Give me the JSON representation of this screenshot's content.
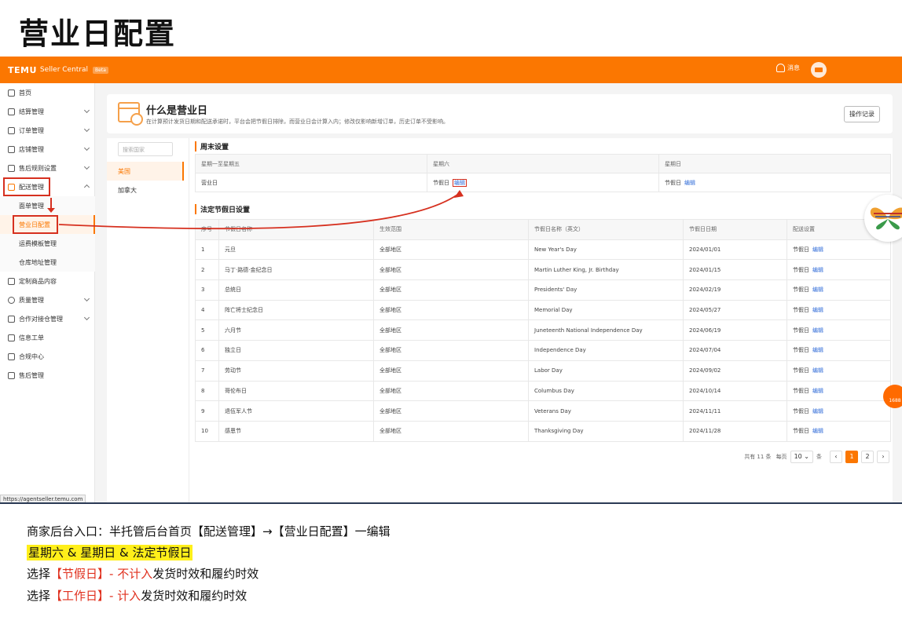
{
  "page_title": "营业日配置",
  "app": {
    "brand": "TEMU",
    "brand_sub": "Seller Central",
    "badge": "Beta",
    "messages_label": "消息",
    "status_url": "https://agentseller.temu.com"
  },
  "sidebar": {
    "items": [
      {
        "label": "首页",
        "icon": "home-icon"
      },
      {
        "label": "结算管理",
        "icon": "wallet-icon"
      },
      {
        "label": "订单管理",
        "icon": "cart-icon"
      },
      {
        "label": "店铺管理",
        "icon": "store-icon"
      },
      {
        "label": "售后规则设置",
        "icon": "rules-icon"
      },
      {
        "label": "配送管理",
        "icon": "truck-icon"
      },
      {
        "label": "面单管理",
        "icon": ""
      },
      {
        "label": "营业日配置",
        "icon": ""
      },
      {
        "label": "运费模板管理",
        "icon": ""
      },
      {
        "label": "仓库地址管理",
        "icon": ""
      },
      {
        "label": "定制商品内容",
        "icon": "custom-icon"
      },
      {
        "label": "质量管理",
        "icon": "shield-icon"
      },
      {
        "label": "合作对接仓管理",
        "icon": "warehouse-icon"
      },
      {
        "label": "信息工单",
        "icon": "ticket-icon"
      },
      {
        "label": "合规中心",
        "icon": "compliance-icon"
      },
      {
        "label": "售后管理",
        "icon": "aftersale-icon"
      }
    ]
  },
  "info": {
    "title": "什么是营业日",
    "desc": "在计算预计发货日期和配送承诺时，平台会把节假日排除，而营业日会计算入内；修改仅影响新增订单，历史订单不受影响。",
    "log_button": "操作记录"
  },
  "countries": {
    "search_placeholder": "搜索国家",
    "items": [
      "美国",
      "加拿大"
    ]
  },
  "weekend": {
    "title": "周末设置",
    "headers": [
      "星期一至星期五",
      "星期六",
      "星期日"
    ],
    "row": [
      "营业日",
      "节假日",
      "节假日"
    ],
    "edit_label": "编辑"
  },
  "holidays": {
    "title": "法定节假日设置",
    "headers": [
      "序号",
      "节假日名称",
      "生效范围",
      "节假日名称（英文）",
      "节假日日期",
      "配送设置"
    ],
    "rows": [
      [
        "1",
        "元旦",
        "全部地区",
        "New Year's Day",
        "2024/01/01",
        "节假日"
      ],
      [
        "2",
        "马丁·路德·金纪念日",
        "全部地区",
        "Martin Luther King, Jr. Birthday",
        "2024/01/15",
        "节假日"
      ],
      [
        "3",
        "总统日",
        "全部地区",
        "Presidents'  Day",
        "2024/02/19",
        "节假日"
      ],
      [
        "4",
        "阵亡将士纪念日",
        "全部地区",
        "Memorial Day",
        "2024/05/27",
        "节假日"
      ],
      [
        "5",
        "六月节",
        "全部地区",
        "Juneteenth National Independence Day",
        "2024/06/19",
        "节假日"
      ],
      [
        "6",
        "独立日",
        "全部地区",
        "Independence Day",
        "2024/07/04",
        "节假日"
      ],
      [
        "7",
        "劳动节",
        "全部地区",
        "Labor Day",
        "2024/09/02",
        "节假日"
      ],
      [
        "8",
        "哥伦布日",
        "全部地区",
        "Columbus Day",
        "2024/10/14",
        "节假日"
      ],
      [
        "9",
        "退伍军人节",
        "全部地区",
        "Veterans Day",
        "2024/11/11",
        "节假日"
      ],
      [
        "10",
        "感恩节",
        "全部地区",
        "Thanksgiving Day",
        "2024/11/28",
        "节假日"
      ]
    ],
    "edit_label": "编辑"
  },
  "pagination": {
    "total": "共有 11 条",
    "per_page_label": "每页",
    "per_page_value": "10",
    "unit": "条",
    "pages": [
      "1",
      "2"
    ],
    "current": "1"
  },
  "float_badge": "1688",
  "caption": {
    "line1": "商家后台入口：半托管后台首页【配送管理】→【营业日配置】一编辑",
    "line2": "星期六 & 星期日 & 法定节假日",
    "line3_a": "选择",
    "line3_b": "【节假日】- 不计入",
    "line3_c": "发货时效和履约时效",
    "line4_a": "选择",
    "line4_b": "【工作日】- 计入",
    "line4_c": "发货时效和履约时效"
  },
  "colors": {
    "accent": "#fb7701",
    "annotation": "#d6301f",
    "highlight": "#ffef1a",
    "link": "#2f6bd8"
  }
}
